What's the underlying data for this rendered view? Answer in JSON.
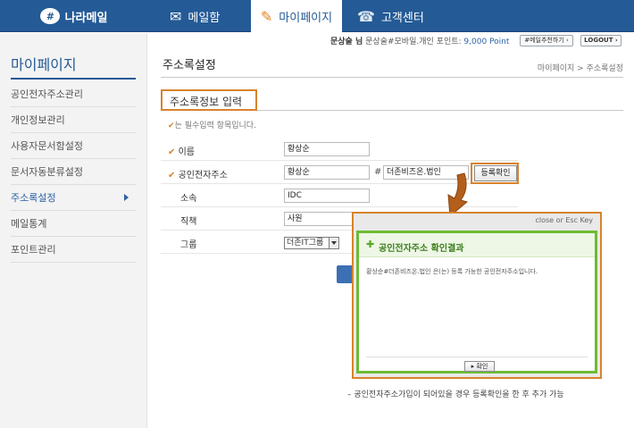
{
  "header": {
    "logo_text": "나라메일",
    "tabs": [
      {
        "label": "메일함"
      },
      {
        "label": "마이페이지"
      },
      {
        "label": "고객센터"
      }
    ]
  },
  "user_bar": {
    "user_name": "문상술 님",
    "user_info": "문상술#모바일.개인",
    "point_label": "포인트:",
    "point_value": "9,000 Point",
    "recommend_label": "#메일추천하기 ›",
    "logout_label": "LOGOUT ›"
  },
  "sidebar": {
    "title": "마이페이지",
    "items": [
      {
        "label": "공인전자주소관리"
      },
      {
        "label": "개인정보관리"
      },
      {
        "label": "사용자문서함설정"
      },
      {
        "label": "문서자동분류설정"
      },
      {
        "label": "주소록설정"
      },
      {
        "label": "메일통계"
      },
      {
        "label": "포인트관리"
      }
    ]
  },
  "main": {
    "title": "주소록설정",
    "breadcrumb": "마이페이지 > 주소록설정",
    "section_title": "주소록정보 입력",
    "required_note": "는 필수입력 항목입니다.",
    "form": {
      "name_label": "이름",
      "name_value": "황상순",
      "address_label": "공인전자주소",
      "address_value1": "황상순",
      "address_separator": "#",
      "address_value2": "더존비즈온.법인",
      "confirm_button": "등록확인",
      "org_label": "소속",
      "org_value": "IDC",
      "position_label": "직책",
      "position_value": "사원",
      "group_label": "그룹",
      "group_value": "더존IT그룹"
    }
  },
  "popup": {
    "close_text": "close or Esc Key",
    "title": "공인전자주소 확인결과",
    "message": "황상순#더존비즈온.법인 은(는) 등록 가능한 공인전자주소입니다.",
    "ok_button": "확인"
  },
  "caption": "– 공인전자주소가입이 되어있을 경우 등록확인을 한 후 추가 가능"
}
